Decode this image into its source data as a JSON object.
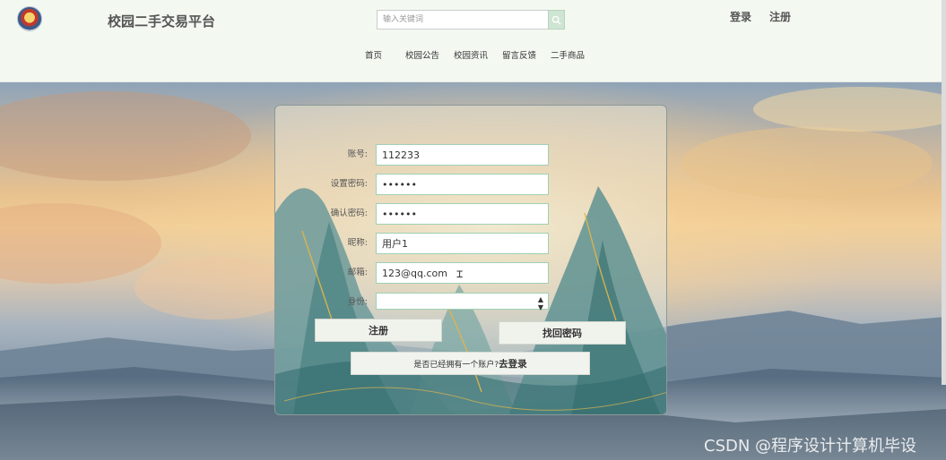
{
  "header": {
    "site_title": "校园二手交易平台",
    "search_placeholder": "输入关键词",
    "login_label": "登录",
    "register_label": "注册",
    "nav": [
      "首页",
      "校园公告",
      "校园资讯",
      "留言反馈",
      "二手商品"
    ]
  },
  "form": {
    "account_label": "账号:",
    "account_value": "112233",
    "password_label": "设置密码:",
    "password_value": "123456",
    "confirm_label": "确认密码:",
    "confirm_value": "123456",
    "nickname_label": "昵称:",
    "nickname_value": "用户1",
    "email_label": "邮箱:",
    "email_value": "123@qq.com",
    "role_label": "身份:",
    "role_value": "",
    "register_button": "注册",
    "recover_button": "找回密码",
    "login_prompt": "是否已经拥有一个账户?",
    "login_link": "去登录"
  },
  "watermark": "CSDN @程序设计计算机毕设",
  "icons": {
    "logo": "school-emblem-icon",
    "search": "search-icon",
    "select_caret": "updown-caret-icon",
    "text_cursor": "text-cursor-icon"
  },
  "colors": {
    "header_bg": "#f3f8f1",
    "input_border": "#9fd0b4",
    "search_button": "#cfe5d4"
  }
}
